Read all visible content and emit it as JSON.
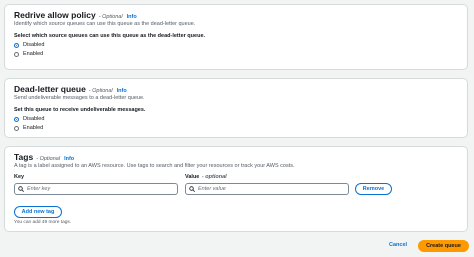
{
  "redrive": {
    "title": "Redrive allow policy",
    "optional": "- Optional",
    "info": "Info",
    "description": "Identify which source queues can use this queue as the dead-letter queue.",
    "field_label": "Select which source queues can use this queue as the dead-letter queue.",
    "options": [
      {
        "label": "Disabled",
        "selected": true
      },
      {
        "label": "Enabled",
        "selected": false
      }
    ]
  },
  "dlq": {
    "title": "Dead-letter queue",
    "optional": "- Optional",
    "info": "Info",
    "description": "Send undeliverable messages to a dead-letter queue.",
    "field_label": "Set this queue to receive undeliverable messages.",
    "options": [
      {
        "label": "Disabled",
        "selected": true
      },
      {
        "label": "Enabled",
        "selected": false
      }
    ]
  },
  "tags": {
    "title": "Tags",
    "optional": "- Optional",
    "info": "Info",
    "description": "A tag is a label assigned to an AWS resource. Use tags to search and filter your resources or track your AWS costs.",
    "key_label": "Key",
    "value_label": "Value",
    "value_optional": "- optional",
    "key_placeholder": "Enter key",
    "value_placeholder": "Enter value",
    "remove_label": "Remove",
    "add_label": "Add new tag",
    "hint": "You can add 49 more tags."
  },
  "footer": {
    "cancel_label": "Cancel",
    "create_label": "Create queue"
  },
  "colors": {
    "accent": "#0972d3",
    "primary_button": "#ff9900",
    "background": "#f2f3f3"
  },
  "icons": {
    "search": "search-icon"
  }
}
